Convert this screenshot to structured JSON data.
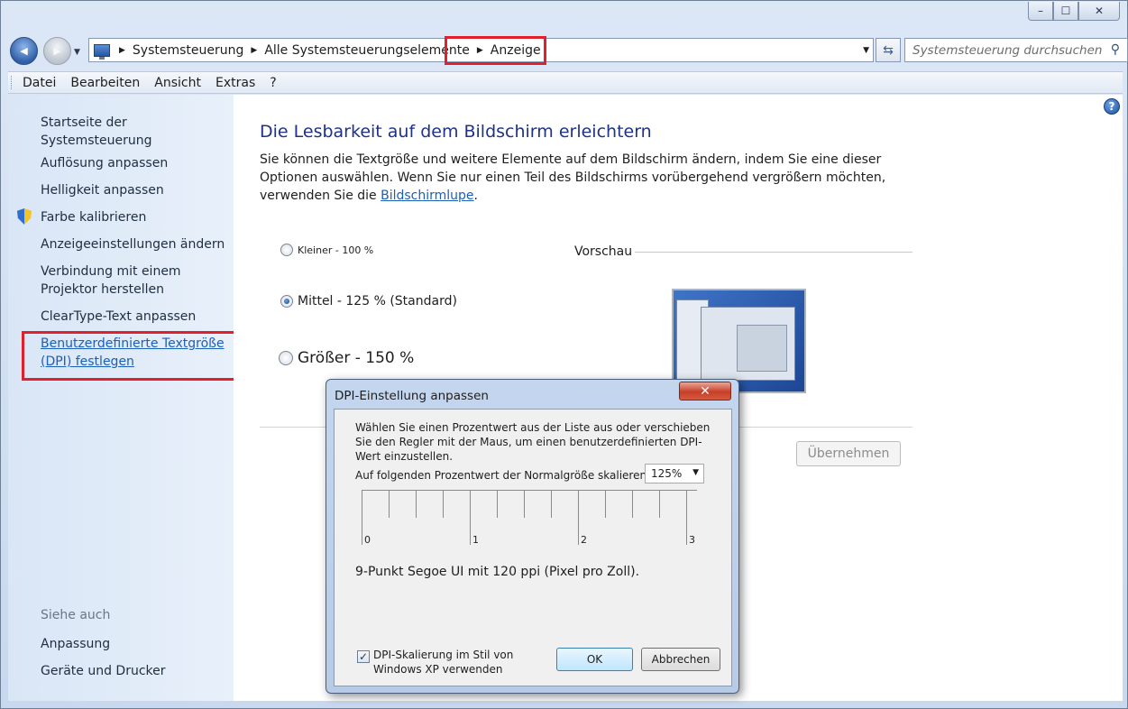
{
  "window": {
    "caption": {
      "minimize": "–",
      "maximize": "☐",
      "close": "✕"
    }
  },
  "nav": {
    "back_icon": "◀",
    "forward_icon": "▶",
    "breadcrumbs": [
      "Systemsteuerung",
      "Alle Systemsteuerungselemente",
      "Anzeige"
    ],
    "search_placeholder": "Systemsteuerung durchsuchen"
  },
  "menu": [
    "Datei",
    "Bearbeiten",
    "Ansicht",
    "Extras",
    "?"
  ],
  "sidebar": {
    "home": "Startseite der Systemsteuerung",
    "items": [
      "Auflösung anpassen",
      "Helligkeit anpassen",
      "Farbe kalibrieren",
      "Anzeigeeinstellungen ändern",
      "Verbindung mit einem Projektor herstellen",
      "ClearType-Text anpassen",
      "Benutzerdefinierte Textgröße (DPI) festlegen"
    ],
    "see_also_label": "Siehe auch",
    "see_also": [
      "Anpassung",
      "Geräte und Drucker"
    ]
  },
  "main": {
    "title": "Die Lesbarkeit auf dem Bildschirm erleichtern",
    "desc": "Sie können die Textgröße und weitere Elemente auf dem Bildschirm ändern, indem Sie eine dieser Optionen auswählen. Wenn Sie nur einen Teil des Bildschirms vorübergehend vergrößern möchten, verwenden Sie die",
    "desc_link": "Bildschirmlupe",
    "desc_end": ".",
    "options": [
      {
        "label": "Kleiner - 100 %",
        "checked": false
      },
      {
        "label": "Mittel - 125 % (Standard)",
        "checked": true
      },
      {
        "label": "Größer - 150 %",
        "checked": false
      }
    ],
    "preview_label": "Vorschau",
    "apply_button": "Übernehmen"
  },
  "dialog": {
    "title": "DPI-Einstellung anpassen",
    "close_icon": "✕",
    "text": "Wählen Sie einen Prozentwert aus der Liste aus oder verschieben Sie den Regler mit der Maus, um einen benutzerdefinierten DPI-Wert einzustellen.",
    "scale_label": "Auf folgenden Prozentwert der Normalgröße skalieren:",
    "scale_value": "125%",
    "ruler_numbers": [
      "0",
      "1",
      "2",
      "3"
    ],
    "info": "9-Punkt Segoe UI mit 120 ppi (Pixel pro Zoll).",
    "checkbox_label": "DPI-Skalierung im Stil von Windows XP verwenden",
    "checkbox_checked": true,
    "ok": "OK",
    "cancel": "Abbrechen"
  }
}
